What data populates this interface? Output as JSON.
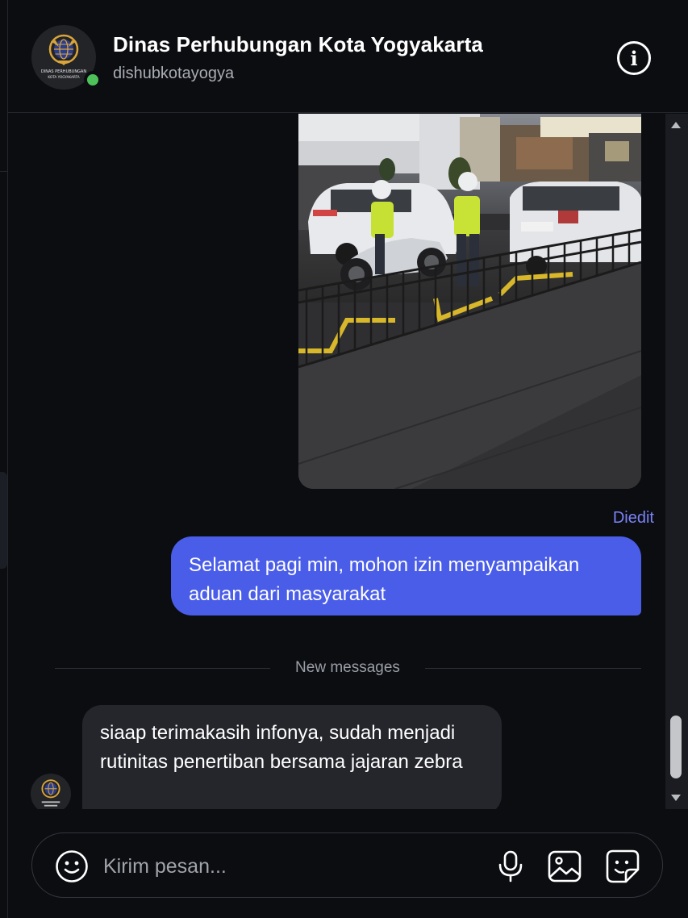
{
  "header": {
    "title": "Dinas Perhubungan Kota Yogyakarta",
    "username": "dishubkotayogya",
    "logo_text_line1": "DINAS PERHUBUNGAN",
    "logo_text_line2": "KOTA YOGYAKARTA",
    "online_color": "#4ec25a"
  },
  "messages": {
    "edited_label": "Diedit",
    "outgoing_text": "Selamat pagi min, mohon izin menyampaikan aduan dari masyarakat",
    "divider_label": "New messages",
    "incoming_text": "siaap terimakasih infonya, sudah menjadi rutinitas penertiban bersama jajaran zebra"
  },
  "composer": {
    "placeholder": "Kirim pesan..."
  },
  "colors": {
    "accent_bubble": "#4a5de9",
    "edited_label": "#7a83f5",
    "incoming_bubble": "#24262c",
    "background": "#0b0d11"
  },
  "icons": [
    "info-icon",
    "emoji-icon",
    "microphone-icon",
    "image-icon",
    "sticker-icon"
  ]
}
